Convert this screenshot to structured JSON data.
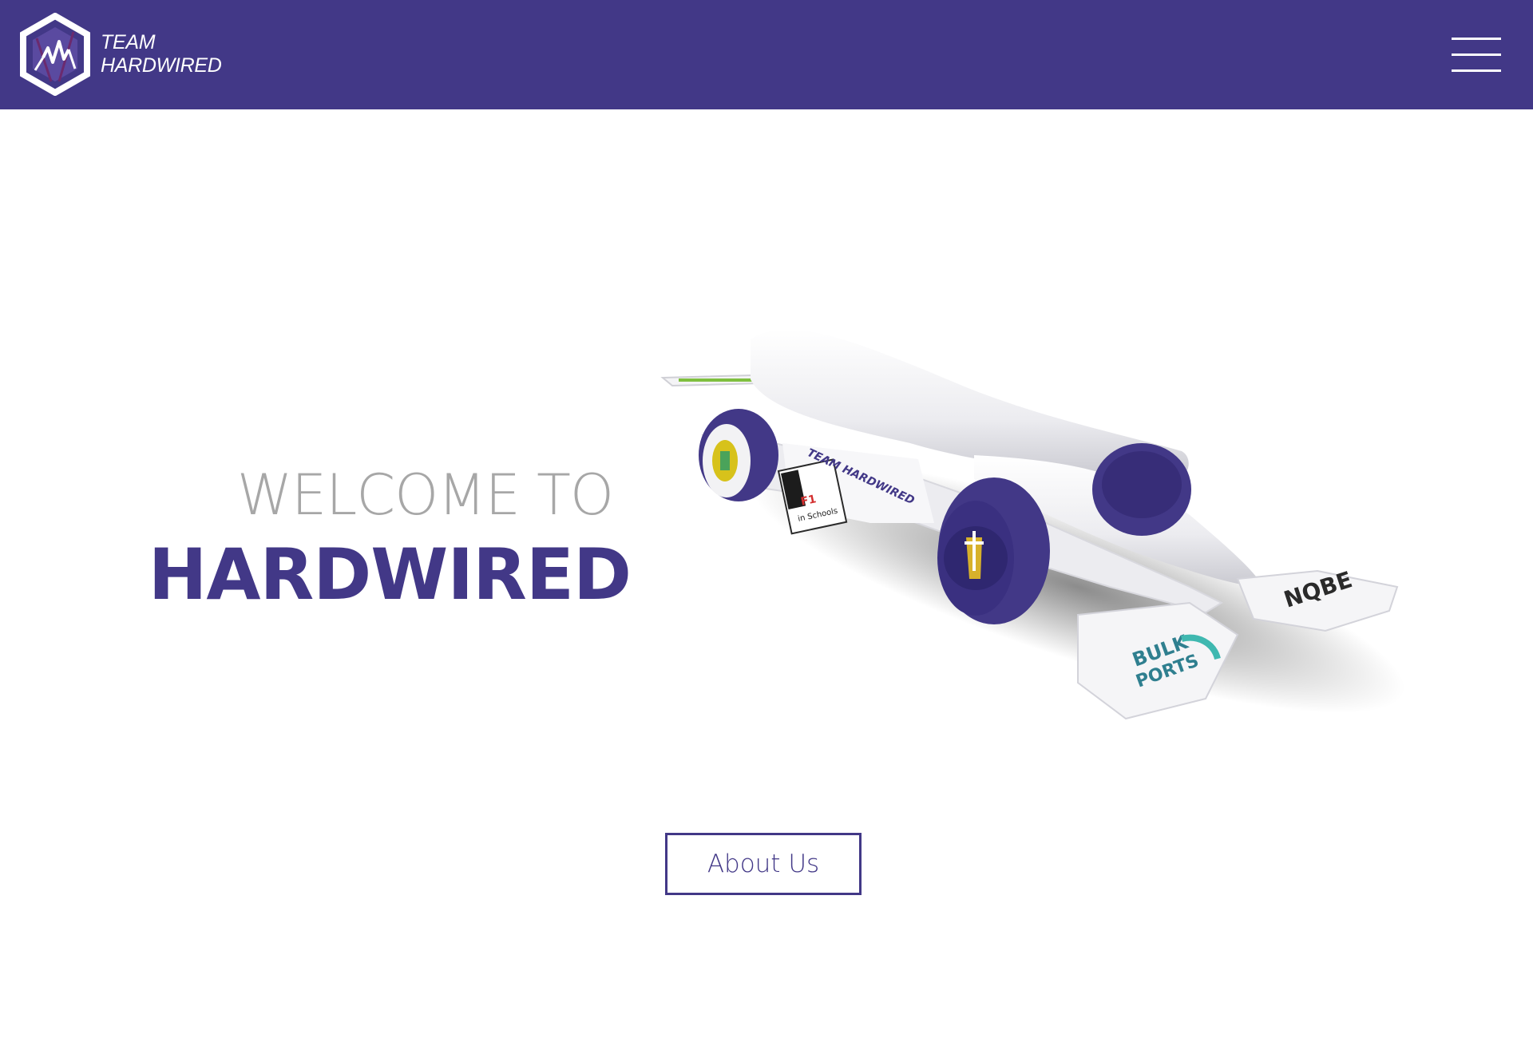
{
  "header": {
    "brand_line1": "TEAM",
    "brand_line2": "HARDWIRED",
    "background_color": "#423887",
    "menu_icon": "hamburger-menu-icon",
    "logo_icon": "hexagon-logo-icon"
  },
  "hero": {
    "welcome": "WELCOME TO",
    "title": "HARDWIRED",
    "title_color": "#423887",
    "welcome_color": "#a7a7a7",
    "image": {
      "kind": "f1-in-schools-race-car-render",
      "sponsors": {
        "front_left_wing": "BULK PORTS",
        "front_right_wing": "NQBE",
        "side_pod": "F1 in Schools",
        "side_team": "TEAM HARDWIRED"
      }
    }
  },
  "cta": {
    "about_label": "About Us"
  }
}
